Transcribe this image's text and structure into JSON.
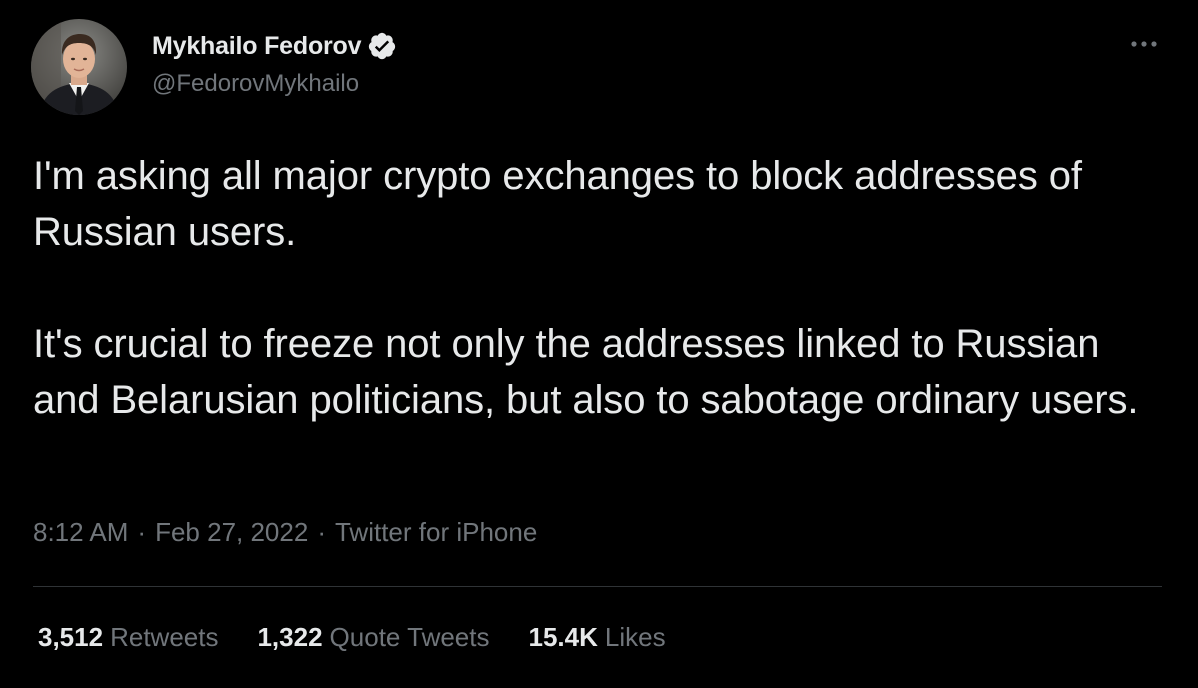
{
  "author": {
    "display_name": "Mykhailo Fedorov",
    "handle": "@FedorovMykhailo",
    "verified": true,
    "avatar_icon": "profile-photo"
  },
  "tweet": {
    "paragraphs": [
      "I'm asking all major crypto exchanges to block addresses of Russian users.",
      "It's crucial to freeze not only the addresses linked to Russian and Belarusian politicians, but also to sabotage ordinary users."
    ]
  },
  "meta": {
    "time": "8:12 AM",
    "date": "Feb 27, 2022",
    "source": "Twitter for iPhone",
    "separator": "·"
  },
  "stats": {
    "retweets_count": "3,512",
    "retweets_label": "Retweets",
    "quotes_count": "1,322",
    "quotes_label": "Quote Tweets",
    "likes_count": "15.4K",
    "likes_label": "Likes"
  },
  "colors": {
    "background": "#000000",
    "primary_text": "#e7e9ea",
    "secondary_text": "#71767b",
    "divider": "#2f3336",
    "verified_badge": "#e7e9ea"
  }
}
